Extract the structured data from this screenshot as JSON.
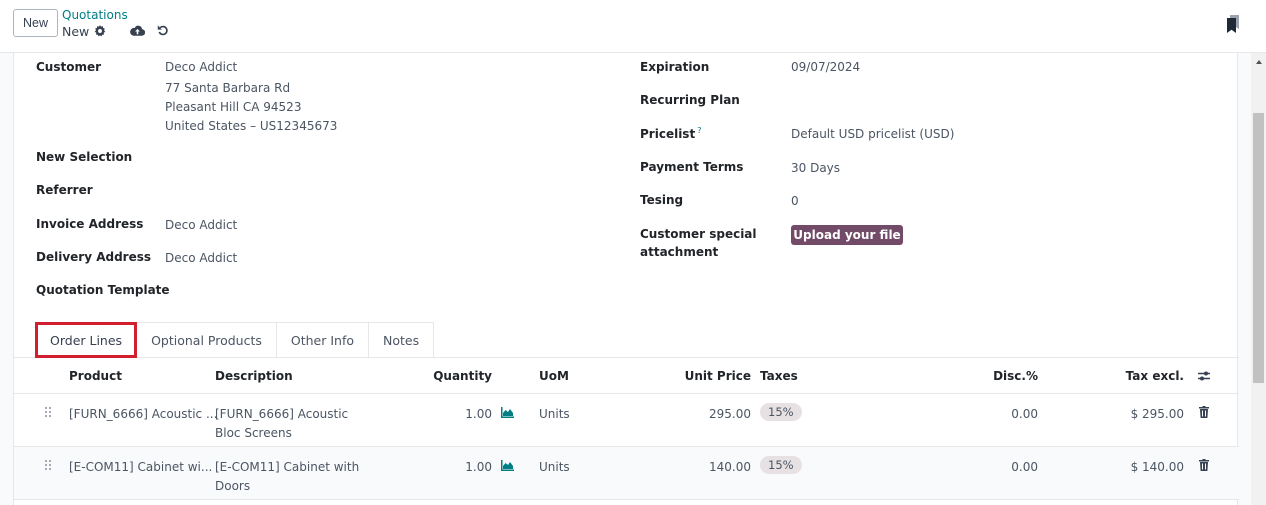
{
  "control_panel": {
    "new_button": "New",
    "breadcrumb": {
      "parent": "Quotations",
      "current": "New"
    },
    "icons": [
      "gear-icon",
      "cloud-upload-icon",
      "undo-icon",
      "bookmark-icon"
    ]
  },
  "form": {
    "left": {
      "customer_label": "Customer",
      "customer_name": "Deco Addict",
      "customer_address_line1": "77 Santa Barbara Rd",
      "customer_address_line2": "Pleasant Hill CA 94523",
      "customer_address_line3": "United States – US12345673",
      "new_selection_label": "New Selection",
      "referrer_label": "Referrer",
      "invoice_address_label": "Invoice Address",
      "invoice_address_value": "Deco Addict",
      "delivery_address_label": "Delivery Address",
      "delivery_address_value": "Deco Addict",
      "quotation_template_label": "Quotation Template"
    },
    "right": {
      "expiration_label": "Expiration",
      "expiration_value": "09/07/2024",
      "recurring_plan_label": "Recurring Plan",
      "pricelist_label": "Pricelist",
      "pricelist_help": "?",
      "pricelist_value": "Default USD pricelist (USD)",
      "payment_terms_label": "Payment Terms",
      "payment_terms_value": "30 Days",
      "tesing_label": "Tesing",
      "tesing_value": "0",
      "special_attachment_label_line1": "Customer special",
      "special_attachment_label_line2": "attachment",
      "upload_button": "Upload your file"
    }
  },
  "tabs": [
    {
      "label": "Order Lines",
      "active": true
    },
    {
      "label": "Optional Products",
      "active": false
    },
    {
      "label": "Other Info",
      "active": false
    },
    {
      "label": "Notes",
      "active": false
    }
  ],
  "order_lines": {
    "columns": [
      "Product",
      "Description",
      "Quantity",
      "UoM",
      "Unit Price",
      "Taxes",
      "Disc.%",
      "Tax excl."
    ],
    "rows": [
      {
        "product": "[FURN_6666] Acoustic ...",
        "description_line1": "[FURN_6666] Acoustic",
        "description_line2": "Bloc Screens",
        "quantity": "1.00",
        "uom": "Units",
        "unit_price": "295.00",
        "tax": "15%",
        "discount": "0.00",
        "subtotal": "$ 295.00"
      },
      {
        "product": "[E-COM11] Cabinet wi...",
        "description_line1": "[E-COM11] Cabinet with",
        "description_line2": "Doors",
        "quantity": "1.00",
        "uom": "Units",
        "unit_price": "140.00",
        "tax": "15%",
        "discount": "0.00",
        "subtotal": "$ 140.00"
      }
    ]
  },
  "colors": {
    "primary": "#714b67",
    "link": "#017e84",
    "highlight_outline": "#d21f2f"
  }
}
